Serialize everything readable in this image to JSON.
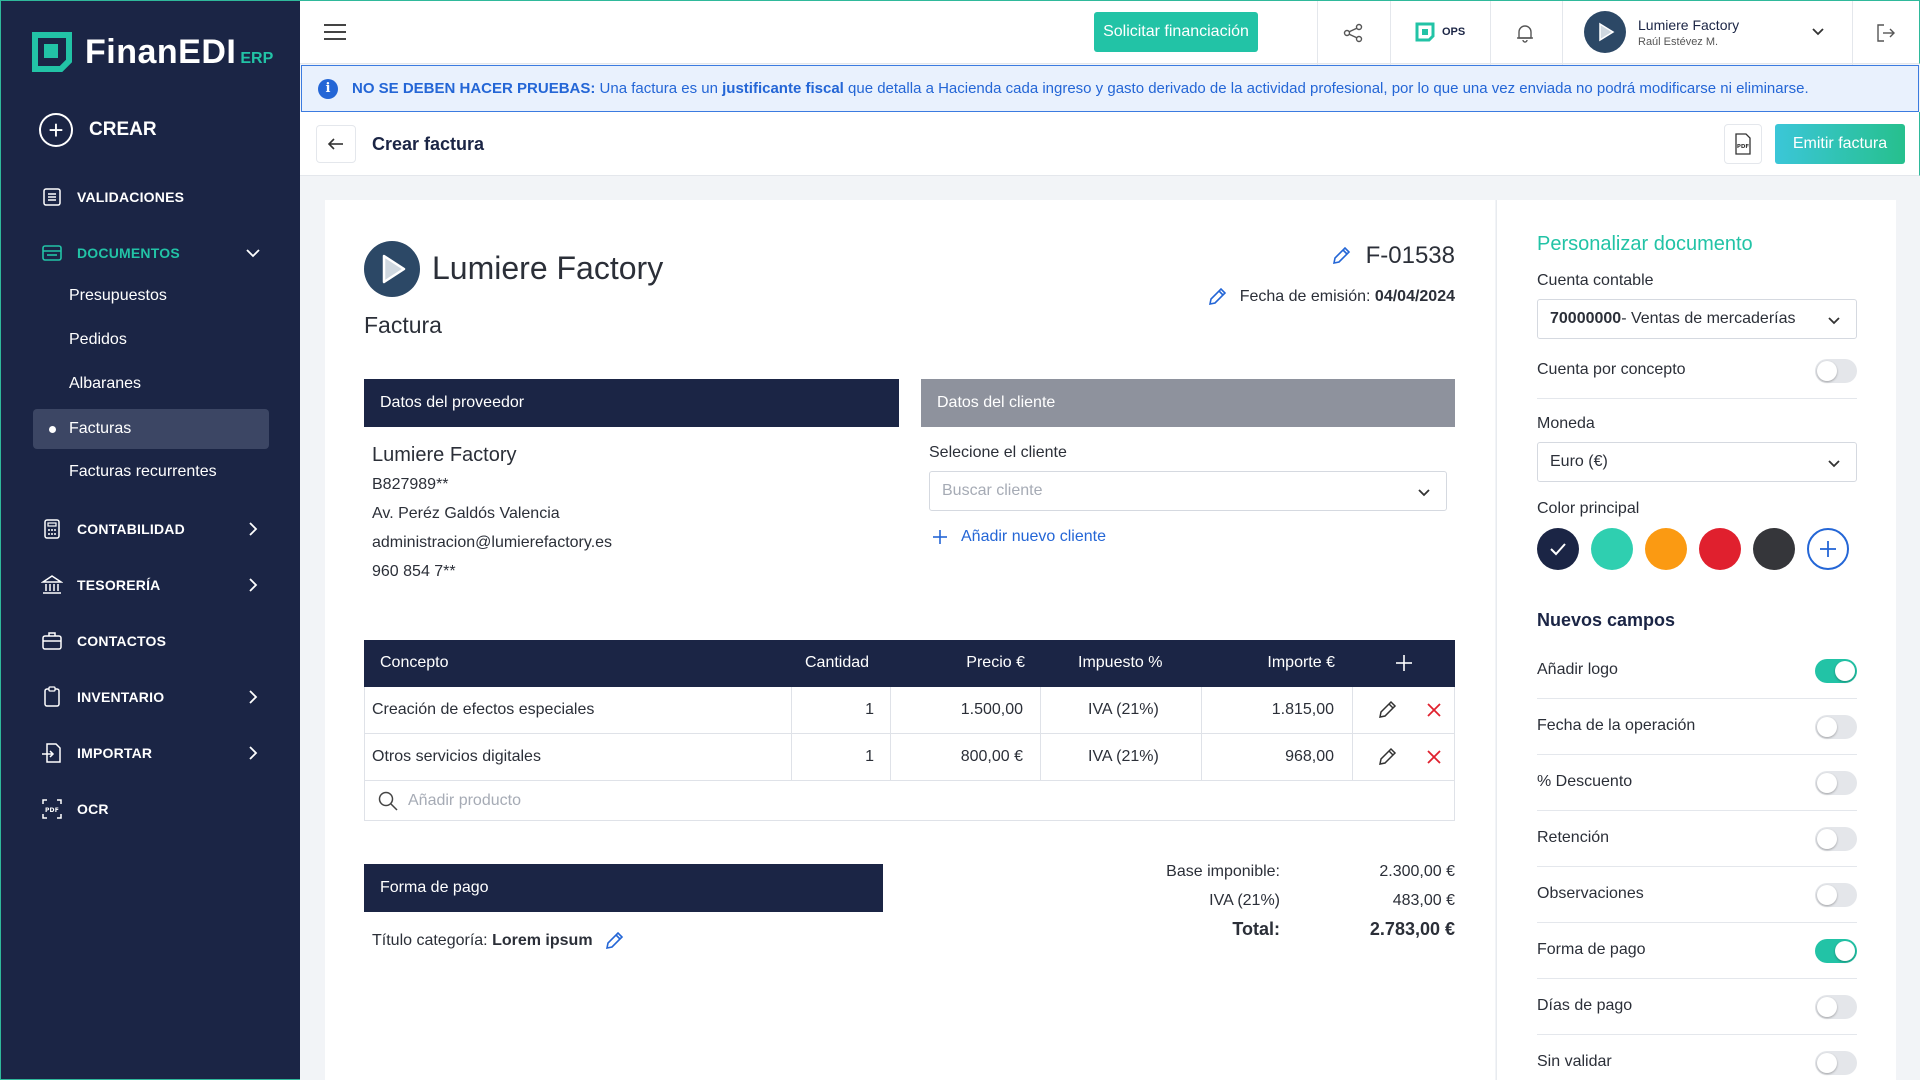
{
  "brand": {
    "name": "FinanEDI",
    "suffix": "ERP"
  },
  "sidebar": {
    "create_label": "CREAR",
    "items": [
      {
        "label": "VALIDACIONES"
      },
      {
        "label": "DOCUMENTOS"
      },
      {
        "label": "CONTABILIDAD"
      },
      {
        "label": "TESORERÍA"
      },
      {
        "label": "CONTACTOS"
      },
      {
        "label": "INVENTARIO"
      },
      {
        "label": "IMPORTAR"
      },
      {
        "label": "OCR"
      }
    ],
    "documents_sub": [
      {
        "label": "Presupuestos"
      },
      {
        "label": "Pedidos"
      },
      {
        "label": "Albaranes"
      },
      {
        "label": "Facturas"
      },
      {
        "label": "Facturas recurrentes"
      }
    ]
  },
  "topbar": {
    "financing_button": "Solicitar financiación",
    "ops_label": "OPS",
    "user_name": "Lumiere Factory",
    "user_sub": "Raúl Estévez M."
  },
  "alert": {
    "strong": "NO SE DEBEN HACER PRUEBAS:",
    "text_1": " Una factura es un ",
    "highlight": "justificante fiscal",
    "text_2": " que detalla a Hacienda cada ingreso y gasto derivado de la actividad profesional, por lo que una vez enviada no podrá modificarse ni eliminarse."
  },
  "header": {
    "title": "Crear factura",
    "emit_button": "Emitir factura"
  },
  "document": {
    "company_name": "Lumiere Factory",
    "doc_type": "Factura",
    "invoice_number": "F-01538",
    "issue_date_label": "Fecha de emisión:",
    "issue_date": "04/04/2024",
    "provider_header": "Datos del proveedor",
    "client_header": "Datos del cliente",
    "provider": {
      "name": "Lumiere Factory",
      "tax_id": "B827989**",
      "address": "Av. Peréz Galdós  Valencia",
      "email": "administracion@lumierefactory.es",
      "phone": "960 854 7**"
    },
    "client": {
      "select_label": "Selecione el cliente",
      "search_placeholder": "Buscar  cliente",
      "add_client": "Añadir nuevo cliente"
    },
    "table": {
      "headers": [
        "Concepto",
        "Cantidad",
        "Precio €",
        "Impuesto %",
        "Importe €"
      ],
      "rows": [
        {
          "concept": "Creación de efectos especiales",
          "qty": "1",
          "price": "1.500,00",
          "tax": "IVA (21%)",
          "amount": "1.815,00"
        },
        {
          "concept": "Otros servicios digitales",
          "qty": "1",
          "price": "800,00 €",
          "tax": "IVA (21%)",
          "amount": "968,00"
        }
      ],
      "add_product_placeholder": "Añadir producto"
    },
    "payment": {
      "header": "Forma de pago",
      "category_label": "Título categoría:",
      "category_value": "Lorem ipsum"
    },
    "totals": {
      "base_label": "Base imponible:",
      "base_value": "2.300,00 €",
      "tax_label": "IVA (21%)",
      "tax_value": "483,00 €",
      "total_label": "Total:",
      "total_value": "2.783,00 €"
    }
  },
  "panel": {
    "title": "Personalizar documento",
    "account_label": "Cuenta contable",
    "account_code": "70000000",
    "account_name": " - Ventas de mercaderías",
    "per_concept_label": "Cuenta por concepto",
    "currency_label": "Moneda",
    "currency_value": "Euro (€)",
    "color_label": "Color principal",
    "colors": [
      "#1b2545",
      "#2fcfb0",
      "#fb9a12",
      "#e0202e",
      "#35363a"
    ],
    "new_fields_title": "Nuevos campos",
    "toggles": [
      {
        "label": "Añadir logo",
        "on": true
      },
      {
        "label": "Fecha de la operación",
        "on": false
      },
      {
        "label": "% Descuento",
        "on": false
      },
      {
        "label": "Retención",
        "on": false
      },
      {
        "label": "Observaciones",
        "on": false
      },
      {
        "label": "Forma de pago",
        "on": true
      },
      {
        "label": "Días de pago",
        "on": false
      },
      {
        "label": "Sin validar",
        "on": false
      }
    ]
  }
}
